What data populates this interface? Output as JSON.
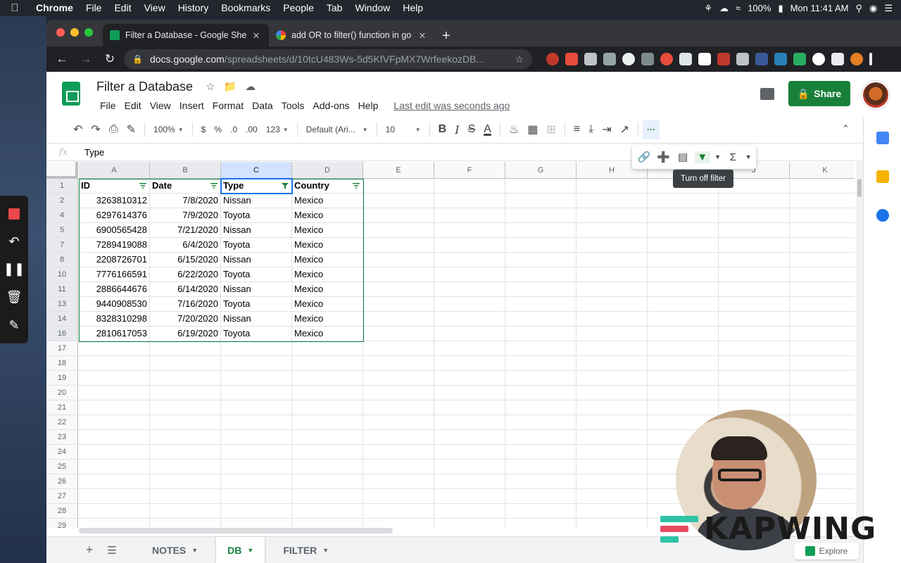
{
  "menubar": {
    "app": "Chrome",
    "items": [
      "File",
      "Edit",
      "View",
      "History",
      "Bookmarks",
      "People",
      "Tab",
      "Window",
      "Help"
    ],
    "battery": "100%",
    "clock": "Mon 11:41 AM"
  },
  "browser": {
    "tabs": [
      {
        "title": "Filter a Database - Google She",
        "favicon": "sheets-favicon",
        "active": true
      },
      {
        "title": "add OR to filter() function in go",
        "favicon": "google-favicon",
        "active": false
      }
    ],
    "url_domain": "docs.google.com",
    "url_path": "/spreadsheets/d/10tcU483Ws-5d5KfVFpMX7WrfeekozDB..."
  },
  "sheet": {
    "title": "Filter a Database",
    "menu": [
      "File",
      "Edit",
      "View",
      "Insert",
      "Format",
      "Data",
      "Tools",
      "Add-ons",
      "Help"
    ],
    "last_edit": "Last edit was seconds ago",
    "share_label": "Share",
    "toolbar": {
      "zoom": "100%",
      "currency": "$",
      "percent": "%",
      "dec_decrease": ".0",
      "dec_increase": ".00",
      "more_formats": "123",
      "font": "Default (Ari...",
      "font_size": "10",
      "bold": "B",
      "italic": "I",
      "strike": "S",
      "text_color": "A",
      "more": "···"
    },
    "formula_value": "Type",
    "columns": [
      "A",
      "B",
      "C",
      "D",
      "E",
      "F",
      "G",
      "H",
      "I",
      "J",
      "K"
    ],
    "header_row": [
      "ID",
      "Date",
      "Type",
      "Country"
    ],
    "rows": [
      {
        "n": "2",
        "id": "3263810312",
        "date": "7/8/2020",
        "type": "Nissan",
        "country": "Mexico"
      },
      {
        "n": "4",
        "id": "6297614376",
        "date": "7/9/2020",
        "type": "Toyota",
        "country": "Mexico"
      },
      {
        "n": "5",
        "id": "6900565428",
        "date": "7/21/2020",
        "type": "Nissan",
        "country": "Mexico"
      },
      {
        "n": "7",
        "id": "7289419088",
        "date": "6/4/2020",
        "type": "Toyota",
        "country": "Mexico"
      },
      {
        "n": "8",
        "id": "2208726701",
        "date": "6/15/2020",
        "type": "Nissan",
        "country": "Mexico"
      },
      {
        "n": "10",
        "id": "7776166591",
        "date": "6/22/2020",
        "type": "Toyota",
        "country": "Mexico"
      },
      {
        "n": "11",
        "id": "2886644676",
        "date": "6/14/2020",
        "type": "Nissan",
        "country": "Mexico"
      },
      {
        "n": "13",
        "id": "9440908530",
        "date": "7/16/2020",
        "type": "Toyota",
        "country": "Mexico"
      },
      {
        "n": "14",
        "id": "8328310298",
        "date": "7/20/2020",
        "type": "Nissan",
        "country": "Mexico"
      },
      {
        "n": "16",
        "id": "2810617053",
        "date": "6/19/2020",
        "type": "Toyota",
        "country": "Mexico"
      }
    ],
    "empty_rows": [
      "17",
      "18",
      "19",
      "20",
      "21",
      "22",
      "23",
      "24",
      "25",
      "26",
      "27",
      "28",
      "29"
    ],
    "sheet_tabs": [
      {
        "label": "NOTES",
        "active": false
      },
      {
        "label": "DB",
        "active": true
      },
      {
        "label": "FILTER",
        "active": false
      }
    ],
    "explore_label": "Explore",
    "tooltip": "Turn off filter"
  },
  "watermark": "KAPWING",
  "colors": {
    "sheets_green": "#0f9d58",
    "share_green": "#188038",
    "selection_green": "#0b8043",
    "active_blue": "#1a73e8"
  }
}
